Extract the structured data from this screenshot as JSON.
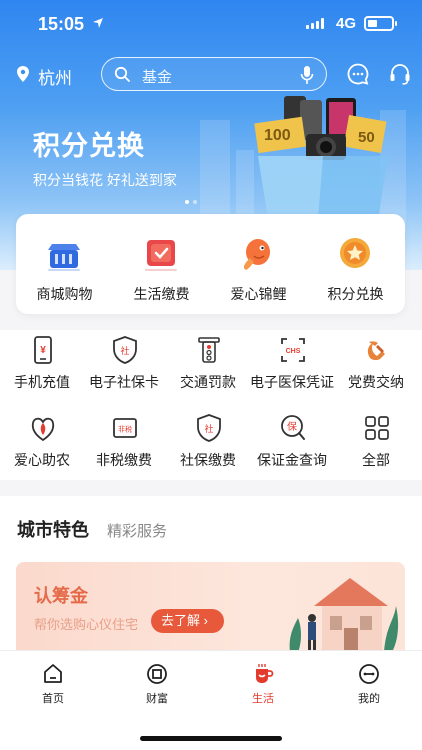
{
  "status_bar": {
    "time": "15:05",
    "network": "4G",
    "battery_level": 0.4
  },
  "header": {
    "city": "杭州",
    "search_placeholder": "基金"
  },
  "banner": {
    "title": "积分兑换",
    "subtitle": "积分当钱花  好礼送到家",
    "price_tag_1": "100",
    "price_tag_2": "50"
  },
  "quick_cards": [
    {
      "label": "商城购物",
      "icon": "shopping-basket-icon"
    },
    {
      "label": "生活缴费",
      "icon": "bill-payment-icon"
    },
    {
      "label": "爱心锦鲤",
      "icon": "koi-fish-icon"
    },
    {
      "label": "积分兑换",
      "icon": "points-star-icon"
    }
  ],
  "services": [
    {
      "label": "手机充值",
      "icon": "phone-recharge-icon"
    },
    {
      "label": "电子社保卡",
      "icon": "social-security-card-icon"
    },
    {
      "label": "交通罚款",
      "icon": "traffic-light-icon"
    },
    {
      "label": "电子医保凭证",
      "icon": "medical-insurance-icon"
    },
    {
      "label": "党费交纳",
      "icon": "party-emblem-icon"
    },
    {
      "label": "爱心助农",
      "icon": "farm-aid-icon"
    },
    {
      "label": "非税缴费",
      "icon": "non-tax-icon"
    },
    {
      "label": "社保缴费",
      "icon": "social-insurance-pay-icon"
    },
    {
      "label": "保证金查询",
      "icon": "deposit-query-icon"
    },
    {
      "label": "全部",
      "icon": "all-grid-icon"
    }
  ],
  "service_icon_text": {
    "recharge": "¥",
    "social_card": "社",
    "medical": "CHS",
    "nontax": "非税",
    "social_pay": "社",
    "deposit": "保"
  },
  "city_section": {
    "title": "城市特色",
    "subtitle": "精彩服务"
  },
  "promo": {
    "title": "认筹金",
    "desc": "帮你选购心仪住宅",
    "button": "去了解"
  },
  "tabs": [
    {
      "label": "首页",
      "icon": "home-icon"
    },
    {
      "label": "财富",
      "icon": "wealth-icon"
    },
    {
      "label": "生活",
      "icon": "life-cup-icon",
      "active": true
    },
    {
      "label": "我的",
      "icon": "profile-icon"
    }
  ],
  "colors": {
    "primary_blue": "#2f86f0",
    "accent_red": "#e33c2e",
    "promo_orange": "#e7593a"
  }
}
